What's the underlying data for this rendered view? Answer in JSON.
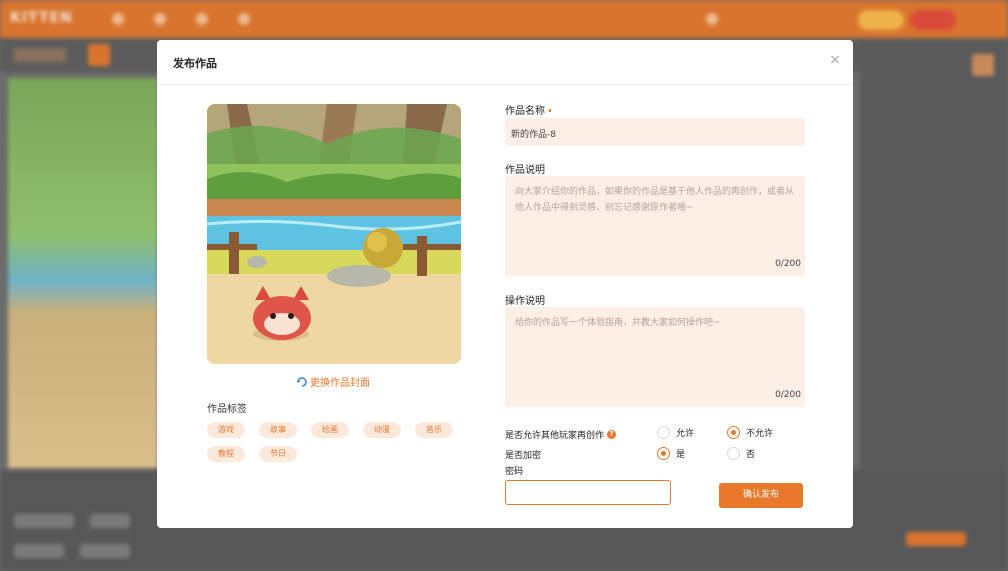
{
  "background_app": {
    "logo": "KITTEN"
  },
  "modal": {
    "title": "发布作品",
    "close_glyph": "×",
    "change_cover_label": "更换作品封面",
    "tags_label": "作品标签",
    "tags": [
      {
        "label": "游戏"
      },
      {
        "label": "故事"
      },
      {
        "label": "绘画"
      },
      {
        "label": "动漫"
      },
      {
        "label": "音乐"
      },
      {
        "label": "教程"
      },
      {
        "label": "节日"
      }
    ],
    "name_field": {
      "label": "作品名称",
      "required_mark": "•",
      "value": "新的作品-8"
    },
    "description_field": {
      "label": "作品说明",
      "placeholder": "向大家介绍你的作品，如果你的作品是基于他人作品的再创作，或者从他人作品中得到灵感，别忘记感谢原作者哦~",
      "counter": "0/200"
    },
    "operation_field": {
      "label": "操作说明",
      "placeholder": "给你的作品写一个体验指南，并教大家如何操作吧~",
      "counter": "0/200"
    },
    "remix_question": {
      "label": "是否允许其他玩家再创作",
      "help_glyph": "?",
      "options": [
        {
          "label": "允许",
          "selected": false
        },
        {
          "label": "不允许",
          "selected": true
        }
      ]
    },
    "encrypt_question": {
      "label": "是否加密",
      "options": [
        {
          "label": "是",
          "selected": true
        },
        {
          "label": "否",
          "selected": false
        }
      ]
    },
    "password_label": "密码",
    "password_value": "",
    "submit_label": "确认发布"
  },
  "colors": {
    "accent": "#e8792c",
    "input_bg": "#fdeee6",
    "tag_bg": "#fde8dc"
  }
}
